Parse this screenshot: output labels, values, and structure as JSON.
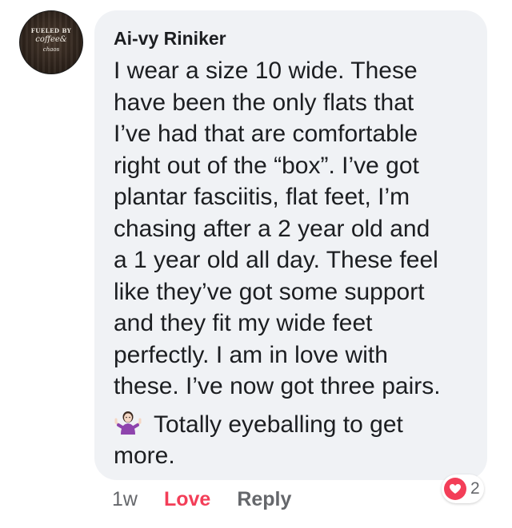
{
  "avatar": {
    "line1": "FUELED BY",
    "line2": "coffee&",
    "line3": "chaos"
  },
  "comment": {
    "author": "Ai-vy Riniker",
    "body": "I wear a size 10 wide. These\nhave been the only flats that\nI’ve had that are comfortable\nright out of the “box”. I’ve got\nplantar fasciitis, flat feet, I’m\nchasing after a 2 year old and\na 1 year old all day. These feel\nlike they’ve got some support\nand they fit my wide feet\nperfectly. I am in love with\nthese. I’ve now got three pairs.",
    "emoji_icon": "person-shrugging-emoji",
    "emoji_text": "Totally eyeballing to get\nmore."
  },
  "actions": {
    "timestamp": "1w",
    "love_label": "Love",
    "reply_label": "Reply"
  },
  "reaction": {
    "icon": "heart-icon",
    "count": "2",
    "color": "#f33e58"
  },
  "colors": {
    "bubble": "#f0f2f5",
    "text": "#1c1e21",
    "secondary": "#65676b",
    "love": "#f33e58"
  }
}
